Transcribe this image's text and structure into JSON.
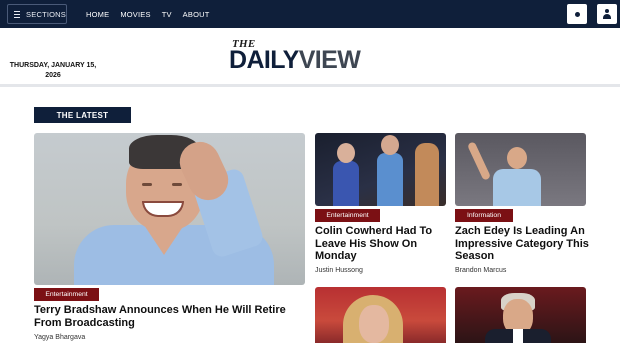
{
  "nav": {
    "sections_label": "SECTIONS",
    "links": [
      "HOME",
      "MOVIES",
      "TV",
      "ABOUT"
    ]
  },
  "masthead": {
    "date": "THURSDAY, JANUARY 15, 2026",
    "logo_the": "THE",
    "logo_daily": "DAILY",
    "logo_view": "VIEW"
  },
  "section_label": "THE LATEST",
  "articles": [
    {
      "tag": "Entertainment",
      "headline": "Terry Bradshaw Announces When He Will Retire From Broadcasting",
      "author": "Yagya Bhargava"
    },
    {
      "tag": "Entertainment",
      "headline": "Colin Cowherd Had To Leave His Show On Monday",
      "author": "Justin Hussong"
    },
    {
      "tag": "Information",
      "headline": "Zach Edey Is Leading An Impressive Category This Season",
      "author": "Brandon Marcus"
    }
  ],
  "icons": {
    "menu": "hamburger-icon",
    "theme": "dot-icon",
    "account": "user-icon"
  },
  "colors": {
    "navy": "#0f1f3a",
    "tag_red": "#7b1014"
  }
}
